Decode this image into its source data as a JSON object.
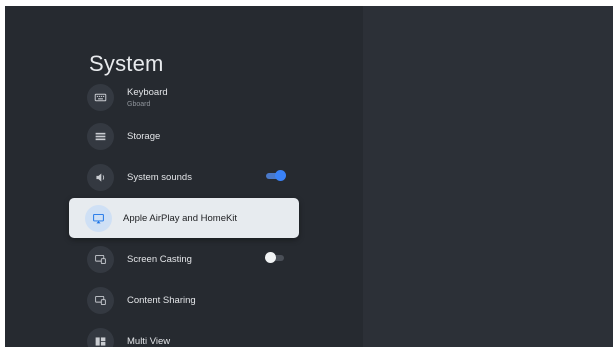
{
  "page": {
    "title": "System"
  },
  "menu": {
    "keyboard": {
      "label": "Keyboard",
      "sublabel": "Gboard",
      "icon": "keyboard-icon"
    },
    "storage": {
      "label": "Storage",
      "icon": "storage-list-icon"
    },
    "system_sounds": {
      "label": "System sounds",
      "icon": "speaker-icon",
      "toggle": "on"
    },
    "airplay": {
      "label": "Apple AirPlay and HomeKit",
      "icon": "airplay-icon",
      "selected": true
    },
    "screen_casting": {
      "label": "Screen Casting",
      "icon": "cast-icon",
      "toggle": "off"
    },
    "content_sharing": {
      "label": "Content Sharing",
      "icon": "cast-icon"
    },
    "multi_view": {
      "label": "Multi View",
      "icon": "multi-view-icon"
    }
  },
  "colors": {
    "background": "#262a30",
    "right_pane": "#2c3037",
    "toggle_on": "#3a82f7",
    "selected_bg": "#e7ebef"
  }
}
